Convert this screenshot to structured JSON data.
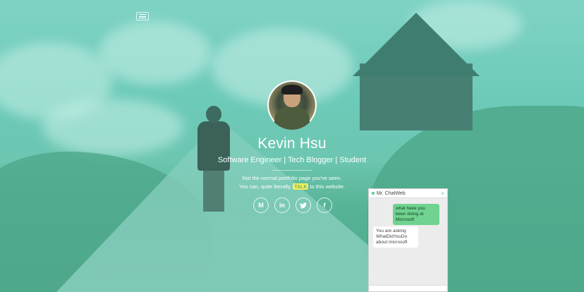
{
  "header": {
    "menu_icon": "hamburger-icon"
  },
  "profile": {
    "name": "Kevin Hsu",
    "tagline": "Software Engineer | Tech Blogger | Student",
    "line1": "Not the normal portfolio page you've seen.",
    "line2_before": "You can, quite literally,",
    "line2_link": "TALK",
    "line2_after": "to this website."
  },
  "socials": [
    {
      "icon": "medium-icon",
      "glyph": "M"
    },
    {
      "icon": "linkedin-icon",
      "glyph": "in"
    },
    {
      "icon": "twitter-icon",
      "glyph": "🐦"
    },
    {
      "icon": "facebook-icon",
      "glyph": "f"
    }
  ],
  "chat": {
    "title": "Mr. ChatWeb",
    "close_glyph": "×",
    "messages": [
      {
        "from": "user",
        "text": "what have you been doing at Microsoft"
      },
      {
        "from": "bot",
        "text": "You are asking WhatDidYouDo about microsoft"
      }
    ]
  },
  "colors": {
    "accent": "#5ccab2",
    "talk_highlight": "#f2ee5b",
    "user_bubble": "#70d38f"
  }
}
